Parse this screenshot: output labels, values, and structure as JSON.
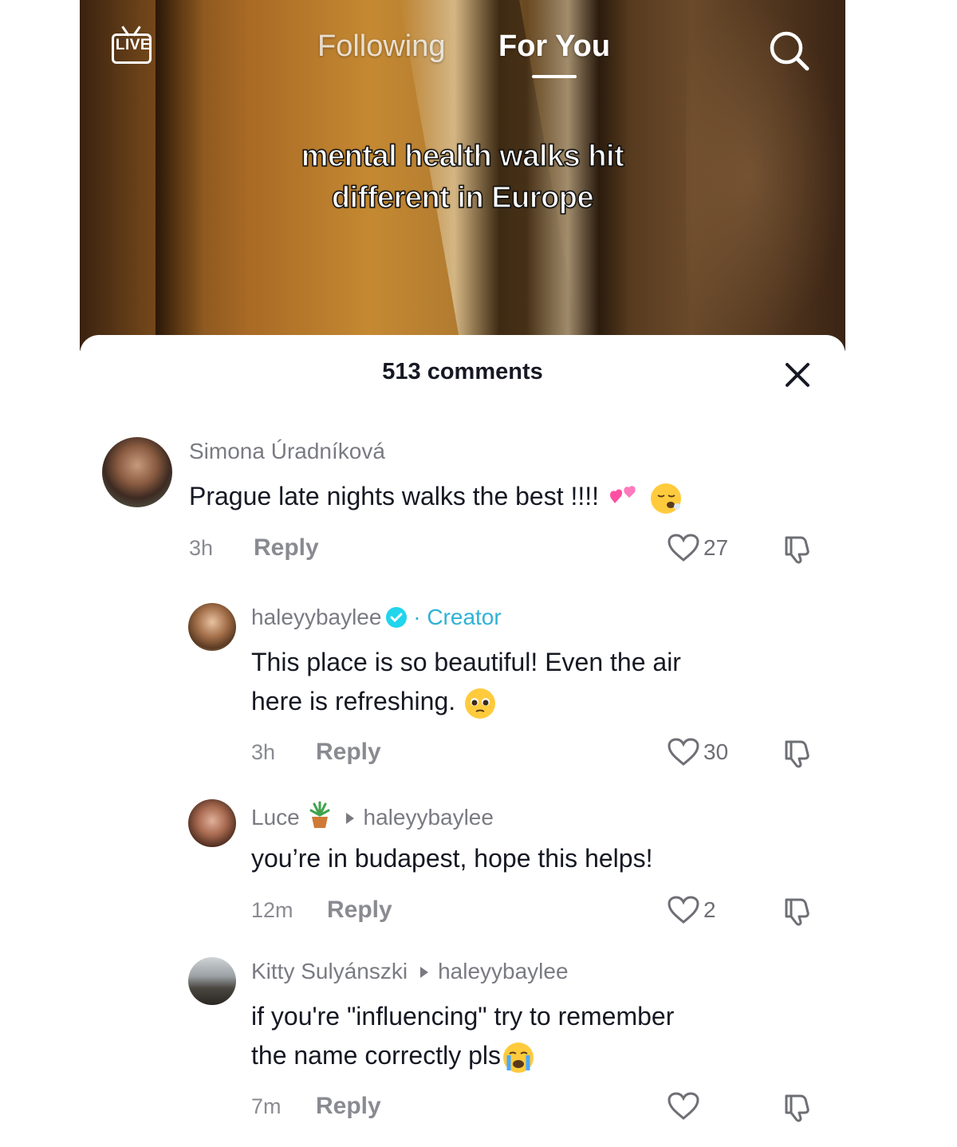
{
  "nav": {
    "live_label": "LIVE",
    "tab_following": "Following",
    "tab_for_you": "For You",
    "active_tab": "For You"
  },
  "video": {
    "caption_line1": "mental health walks hit",
    "caption_line2": "different in Europe"
  },
  "comments_panel": {
    "title": "513 comments",
    "comments": [
      {
        "username": "Simona Úradníková",
        "text": "Prague late nights walks the best !!!!",
        "time": "3h",
        "reply_label": "Reply",
        "likes": "27"
      },
      {
        "username": "haleyybaylee",
        "badge": "· Creator",
        "text_line1": "This place is so beautiful! Even the air",
        "text_line2": "here is refreshing.",
        "time": "3h",
        "reply_label": "Reply",
        "likes": "30"
      },
      {
        "username": "Luce",
        "reply_to": "haleyybaylee",
        "text": "you’re in budapest, hope this helps!",
        "time": "12m",
        "reply_label": "Reply",
        "likes": "2"
      },
      {
        "username": "Kitty Sulyánszki",
        "reply_to": "haleyybaylee",
        "text_line1": "if you're \"influencing\" try to remember",
        "text_line2": "the name correctly pls",
        "time": "7m",
        "reply_label": "Reply",
        "likes": ""
      }
    ]
  },
  "colors": {
    "creator_accent": "#2fb1d6",
    "verified_badge": "#20d5ec",
    "text_primary": "#161823",
    "text_secondary": "#8a8b91"
  }
}
